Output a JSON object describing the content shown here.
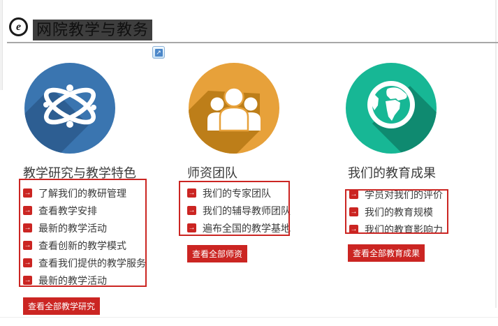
{
  "header": {
    "title": "网院教学与教务",
    "logo_letter": "e"
  },
  "icons": {
    "link_arrow": "→",
    "external_link_arrow": "↗"
  },
  "colors": {
    "accent_red": "#cb2522",
    "circle_blue": "#3a75b0",
    "circle_blue_shadow": "#2d5e92",
    "circle_orange": "#e7a13a",
    "circle_orange_shadow": "#bd7e19",
    "circle_green": "#17b795",
    "circle_green_shadow": "#0f8a70"
  },
  "columns": [
    {
      "icon": "atom-icon",
      "title": "教学研究与教学特色",
      "links": [
        "了解我们的教研管理",
        "查看教学安排",
        "最新的教学活动",
        "查看创新的教学模式",
        "查看我们提供的教学服务",
        "最新的教学活动"
      ],
      "button": "查看全部教学研究"
    },
    {
      "icon": "team-icon",
      "title": "师资团队",
      "links": [
        "我们的专家团队",
        "我们的辅导教师团队",
        "遍布全国的教学基地"
      ],
      "button": "查看全部师资"
    },
    {
      "icon": "globe-icon",
      "title": "我们的教育成果",
      "links": [
        "学员对我们的评价",
        "我们的教育规模",
        "我们的教育影响力"
      ],
      "button": "查看全部教育成果"
    }
  ]
}
